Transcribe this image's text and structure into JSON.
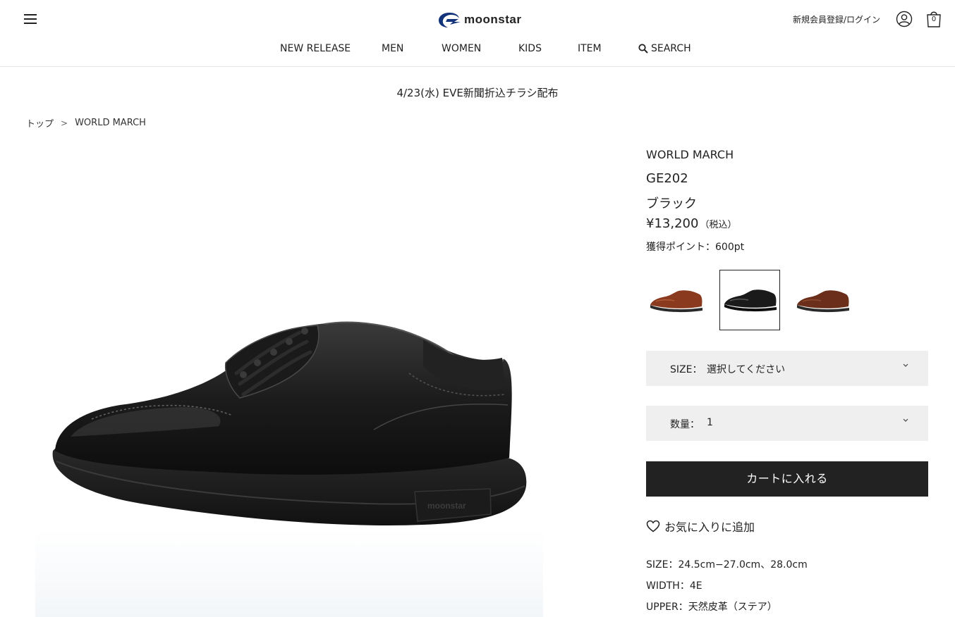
{
  "header": {
    "logo_text": "moonstar",
    "login_label": "新規会員登録/ログイン",
    "cart_count": "0",
    "brand_color": "#13347a"
  },
  "nav": {
    "items": [
      {
        "label": "NEW RELEASE"
      },
      {
        "label": "MEN"
      },
      {
        "label": "WOMEN"
      },
      {
        "label": "KIDS"
      },
      {
        "label": "ITEM"
      },
      {
        "label": "SEARCH"
      }
    ]
  },
  "announcement": "4/23(水) EVE新聞折込チラシ配布",
  "breadcrumb": {
    "home": "トップ",
    "separator": ">",
    "current": "WORLD MARCH"
  },
  "product": {
    "brand": "WORLD MARCH",
    "model": "GE202",
    "color": "ブラック",
    "price": "¥13,200",
    "tax_note": "（税込）",
    "points": "獲得ポイント：600pt",
    "image_sole_logo": "moonstar",
    "swatches": [
      {
        "color": "brown",
        "hex": "#8a3a1e",
        "selected": false
      },
      {
        "color": "black",
        "hex": "#1a1a1a",
        "selected": true
      },
      {
        "color": "dark-brown",
        "hex": "#6a2e1a",
        "selected": false
      }
    ],
    "size_select": {
      "label": "SIZE：",
      "value": "選択してください"
    },
    "qty_select": {
      "label": "数量：",
      "value": "1"
    },
    "cart_button": "カートに入れる",
    "favorite": "お気に入りに追加",
    "specs": [
      "SIZE：24.5cm−27.0cm、28.0cm",
      "WIDTH：4E",
      "UPPER：天然皮革（ステア）"
    ]
  }
}
